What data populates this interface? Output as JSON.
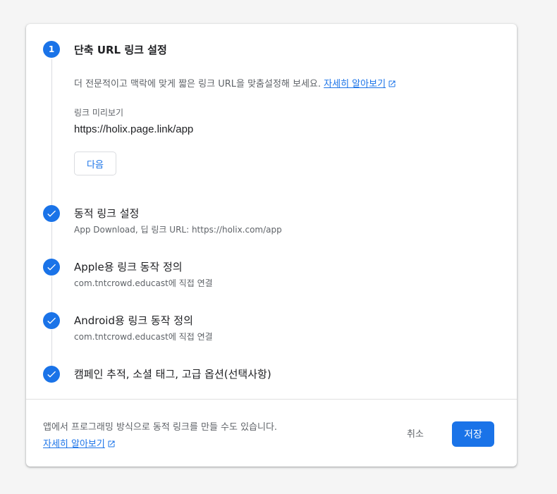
{
  "steps": [
    {
      "number": "1",
      "title": "단축 URL 링크 설정",
      "state": "active"
    },
    {
      "title": "동적 링크 설정",
      "subtitle": "App Download, 딥 링크 URL: https://holix.com/app",
      "state": "done"
    },
    {
      "title": "Apple용 링크 동작 정의",
      "subtitle": "com.tntcrowd.educast에 직접 연결",
      "state": "done"
    },
    {
      "title": "Android용 링크 동작 정의",
      "subtitle": "com.tntcrowd.educast에 직접 연결",
      "state": "done"
    },
    {
      "title": "캠페인 추적, 소셜 태그, 고급 옵션(선택사항)",
      "state": "done"
    }
  ],
  "step1": {
    "description": "더 전문적이고 맥락에 맞게 짧은 링크 URL을 맞춤설정해 보세요.",
    "learn_more": "자세히 알아보기",
    "preview_label": "링크 미리보기",
    "preview_value": "https://holix.page.link/app",
    "next_label": "다음"
  },
  "footer": {
    "text": "앱에서 프로그래밍 방식으로 동적 링크를 만들 수도 있습니다.",
    "learn_more": "자세히 알아보기",
    "cancel_label": "취소",
    "save_label": "저장"
  },
  "colors": {
    "accent": "#1a73e8",
    "line": "#dadce0"
  },
  "icons": {
    "step_done": "check-icon",
    "external": "open-in-new-icon"
  }
}
